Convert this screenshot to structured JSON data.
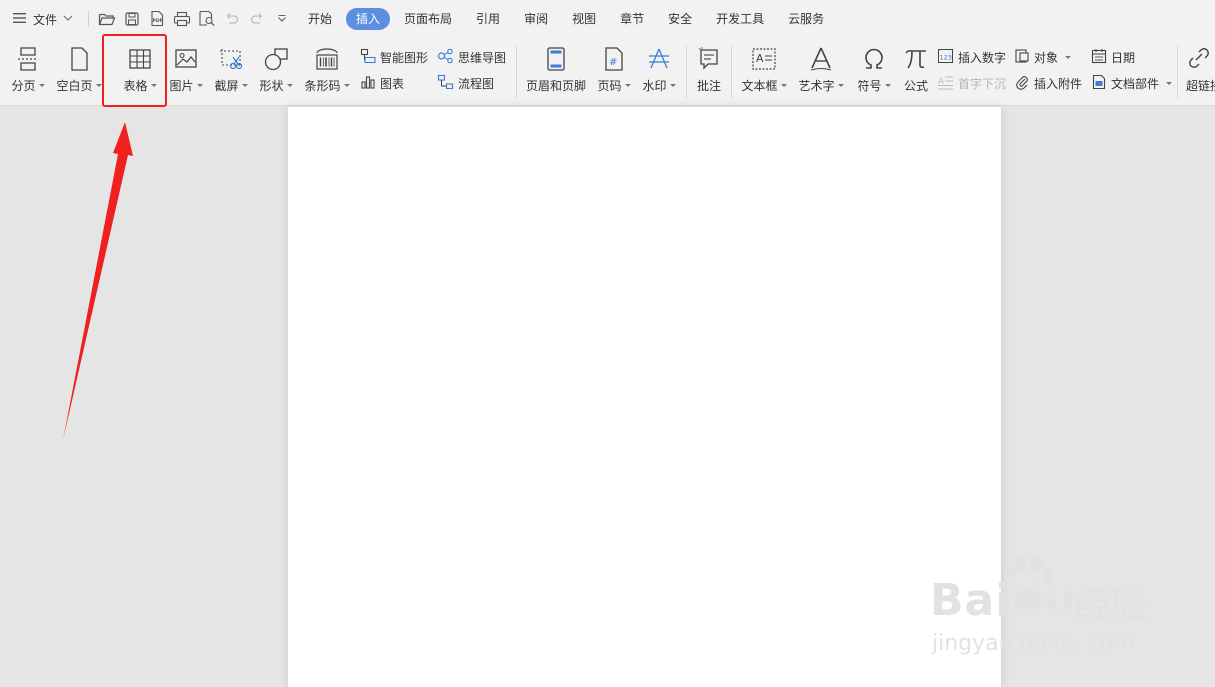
{
  "menubar": {
    "file_label": "文件",
    "quick_access_icons": [
      "open-folder-icon",
      "save-icon",
      "export-pdf-icon",
      "print-icon",
      "print-preview-icon",
      "undo-icon",
      "redo-icon",
      "customize-dropdown-icon"
    ],
    "tabs": [
      {
        "label": "开始",
        "active": false
      },
      {
        "label": "插入",
        "active": true
      },
      {
        "label": "页面布局",
        "active": false
      },
      {
        "label": "引用",
        "active": false
      },
      {
        "label": "审阅",
        "active": false
      },
      {
        "label": "视图",
        "active": false
      },
      {
        "label": "章节",
        "active": false
      },
      {
        "label": "安全",
        "active": false
      },
      {
        "label": "开发工具",
        "active": false
      },
      {
        "label": "云服务",
        "active": false
      }
    ],
    "active_color": "#5b8fdf"
  },
  "ribbon": {
    "page_break": "分页",
    "blank_page": "空白页",
    "table": "表格",
    "picture": "图片",
    "screenshot": "截屏",
    "shape": "形状",
    "barcode": "条形码",
    "smart_art": "智能图形",
    "chart": "图表",
    "mind_map": "思维导图",
    "flowchart": "流程图",
    "header_footer": "页眉和页脚",
    "page_number": "页码",
    "watermark": "水印",
    "comment": "批注",
    "text_box": "文本框",
    "word_art": "艺术字",
    "symbol": "符号",
    "formula": "公式",
    "insert_number": "插入数字",
    "drop_cap": "首字下沉",
    "object": "对象",
    "attachment": "插入附件",
    "date": "日期",
    "doc_parts": "文档部件",
    "hyperlink": "超链接"
  },
  "annotation": {
    "highlight_color": "#f02020"
  },
  "watermark_logo": {
    "brand": "Baidu",
    "brand_cn": "经验",
    "url": "jingyan.baidu.com"
  }
}
